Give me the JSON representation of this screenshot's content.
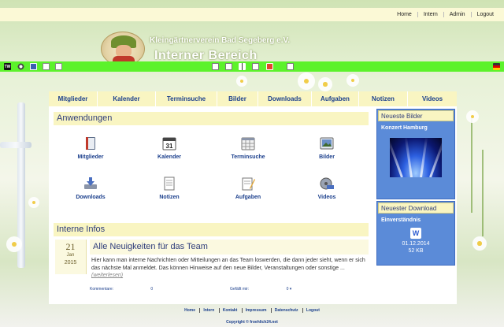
{
  "top_nav": [
    "Home",
    "Intern",
    "Admin",
    "Logout"
  ],
  "header": {
    "title": "Kleingärtnerverein Bad Segeberg e.V.",
    "subtitle": "Interner Bereich"
  },
  "admin_bar": {
    "badge": "TW",
    "icons": [
      "gear-icon",
      "image-icon",
      "pages-icon",
      "new-page-icon",
      "document-icon",
      "arrow-right-icon",
      "arrow-left-icon",
      "edit-icon",
      "shield-icon",
      "mail-icon",
      "flag-icon"
    ]
  },
  "main_nav": [
    "Mitglieder",
    "Kalender",
    "Terminsuche",
    "Bilder",
    "Downloads",
    "Aufgaben",
    "Notizen",
    "Videos"
  ],
  "applications": {
    "title": "Anwendungen",
    "items": [
      {
        "label": "Mitglieder",
        "icon": "members-book-icon"
      },
      {
        "label": "Kalender",
        "icon": "calendar-icon"
      },
      {
        "label": "Terminsuche",
        "icon": "schedule-grid-icon"
      },
      {
        "label": "Bilder",
        "icon": "picture-icon"
      },
      {
        "label": "Downloads",
        "icon": "download-tray-icon"
      },
      {
        "label": "Notizen",
        "icon": "notes-icon"
      },
      {
        "label": "Aufgaben",
        "icon": "tasks-pencil-icon"
      },
      {
        "label": "Videos",
        "icon": "video-reel-icon"
      }
    ],
    "calendar_day": "31"
  },
  "info": {
    "title": "Interne Infos",
    "news": {
      "day": "21",
      "month": "Jan",
      "year": "2015",
      "title": "Alle Neuigkeiten für das Team",
      "body": "Hier kann man interne Nachrichten oder Mitteilungen an das Team loswerden, die dann jeder sieht, wenn er sich das nächste Mal anmeldet. Das können Hinweise auf den neue Bilder, Veranstaltungen oder sonstige ...",
      "more": "(weiterlesen)",
      "comments_label": "Kommentare:",
      "comments_count": "0",
      "likes_label": "Gefällt mir:",
      "likes_count": "0"
    }
  },
  "sidebar": {
    "pictures": {
      "title": "Neueste Bilder",
      "caption": "Konzert Hamburg"
    },
    "download": {
      "title": "Neuester Download",
      "caption": "Einverständnis",
      "icon_letter": "W",
      "date": "01.12.2014",
      "size": "52 KB"
    }
  },
  "footer": {
    "links": [
      "Home",
      "Intern",
      "Kontakt",
      "Impressum",
      "Datenschutz",
      "Logout"
    ],
    "copyright": "Copyright © froehlich24.net"
  },
  "colors": {
    "accent": "#5cf22b",
    "nav_bg": "#f9f5c2",
    "link": "#1b3f8c",
    "sidebar": "#5b8bd8"
  }
}
